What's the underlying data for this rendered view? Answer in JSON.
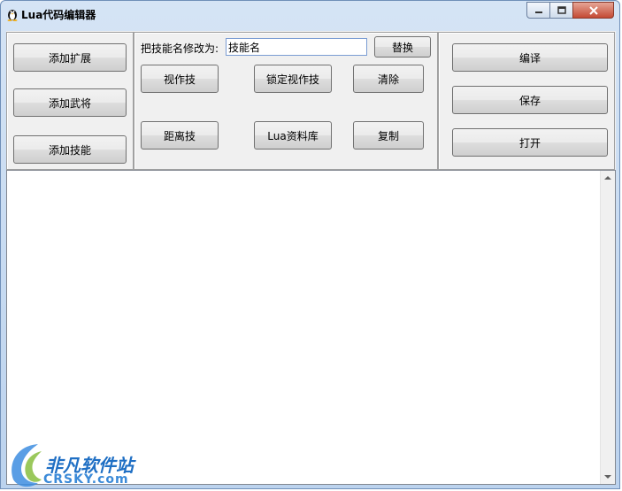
{
  "window": {
    "title": "Lua代码编辑器"
  },
  "caption_buttons": {
    "minimize": "minimize",
    "maximize": "maximize",
    "close": "close"
  },
  "left_panel": {
    "buttons": [
      "添加扩展",
      "添加武将",
      "添加技能"
    ]
  },
  "middle_panel": {
    "rename_label": "把技能名修改为:",
    "rename_input_value": "技能名",
    "replace_button": "替换",
    "buttons": [
      "视作技",
      "锁定视作技",
      "清除",
      "距离技",
      "Lua资料库",
      "复制"
    ]
  },
  "right_panel": {
    "buttons": [
      "编译",
      "保存",
      "打开"
    ]
  },
  "editor": {
    "content": ""
  },
  "watermark": {
    "line1": "非凡软件站",
    "line2": "CRSKY.com"
  },
  "colors": {
    "title_bar": "#c9dcf2",
    "client_bg": "#f0f0f0",
    "close_button": "#c44a34",
    "watermark": "#1f6fc4"
  }
}
